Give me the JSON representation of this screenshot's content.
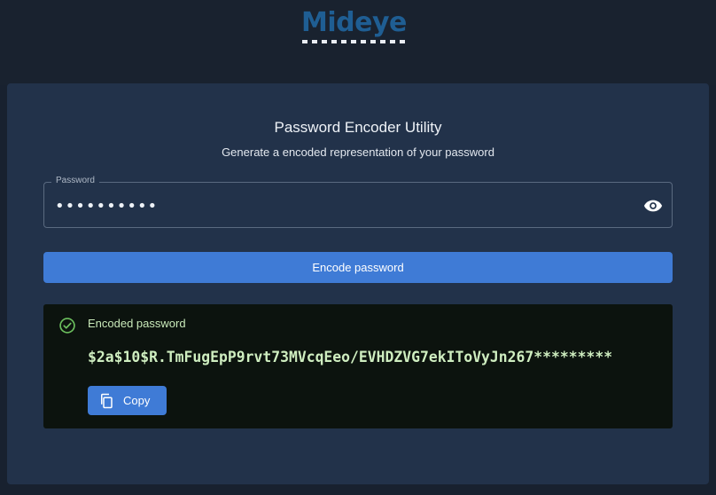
{
  "header": {
    "logo_text": "Mideye"
  },
  "card": {
    "title": "Password Encoder Utility",
    "subtitle": "Generate a encoded representation of your password"
  },
  "password_field": {
    "label": "Password",
    "value": "••••••••••",
    "icon": "eye-icon"
  },
  "encode_button": {
    "label": "Encode password"
  },
  "result": {
    "label": "Encoded password",
    "status_icon": "check-circle-icon",
    "hash": "$2a$10$R.TmFugEpP9rvt73MVcqEeo/EVHDZVG7ekIToVyJn267*********",
    "copy_label": "Copy",
    "copy_icon": "copy-icon"
  },
  "colors": {
    "background": "#18212f",
    "card": "#22324a",
    "accent": "#3f7bd6",
    "result_bg": "#0c130e",
    "result_text": "#cfeec0",
    "logo": "#1f5e93"
  }
}
